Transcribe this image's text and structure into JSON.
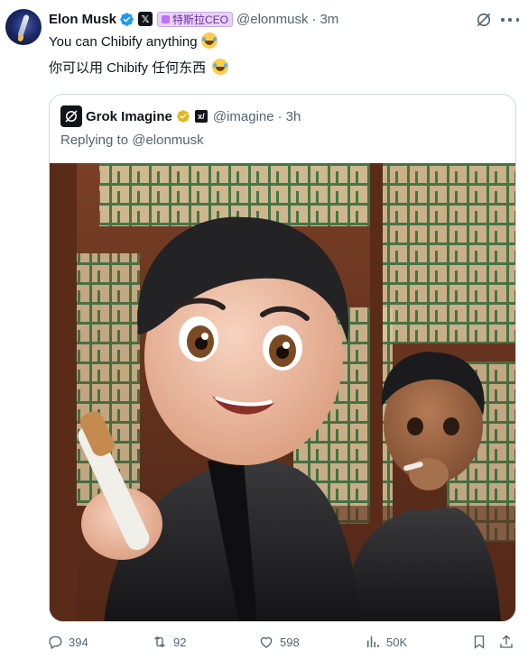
{
  "author": {
    "name": "Elon Musk",
    "badge_label": "特斯拉CEO",
    "handle": "@elonmusk",
    "time": "3m"
  },
  "post": {
    "line1": "You can Chibify anything",
    "line2": "你可以用 Chibify 任何东西"
  },
  "quoted": {
    "name": "Grok Imagine",
    "handle": "@imagine",
    "time": "3h",
    "replying": "Replying to @elonmusk"
  },
  "actions": {
    "replies": "394",
    "reposts": "92",
    "likes": "598",
    "views": "50K"
  },
  "icons": [
    "grok-icon",
    "more-icon",
    "verified-icon",
    "x-logo-icon",
    "reply-icon",
    "repost-icon",
    "like-icon",
    "views-icon",
    "bookmark-icon",
    "share-icon"
  ],
  "colors": {
    "verified_blue": "#1d9bf0",
    "verified_gold": "#e2b719",
    "muted_text": "#536471",
    "border": "#cfd9de"
  }
}
